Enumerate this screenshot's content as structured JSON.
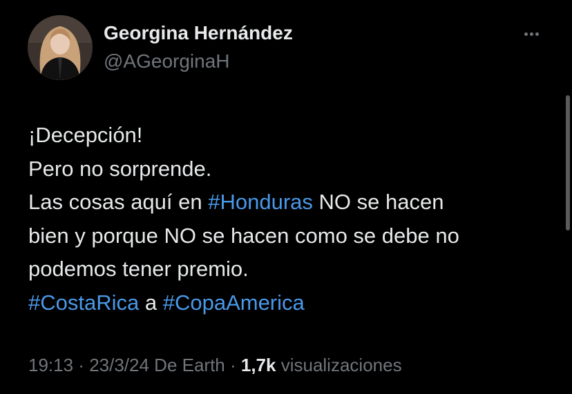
{
  "author": {
    "name": "Georgina Hernández",
    "handle": "@AGeorginaH",
    "avatar_icon": "profile-photo"
  },
  "more_icon": "more-dots-icon",
  "tweet": {
    "line1": "¡Decepción!",
    "line2": "Pero no sorprende.",
    "line3_pre": "Las cosas aquí en ",
    "line3_tag": "#Honduras",
    "line3_post": " NO se hacen",
    "line4": "bien y porque NO se hacen como se debe no",
    "line5": "podemos tener premio.",
    "line6_tag1": "#CostaRica",
    "line6_mid": " a ",
    "line6_tag2": "#CopaAmerica"
  },
  "meta": {
    "time": "19:13",
    "sep1": " · ",
    "date": "23/3/24",
    "source": " De Earth",
    "sep2": " · ",
    "views_count": "1,7k",
    "views_label": " visualizaciones"
  },
  "colors": {
    "background": "#000000",
    "text": "#e7e9ea",
    "secondary": "#71767b",
    "hashtag": "#4a99e9"
  }
}
